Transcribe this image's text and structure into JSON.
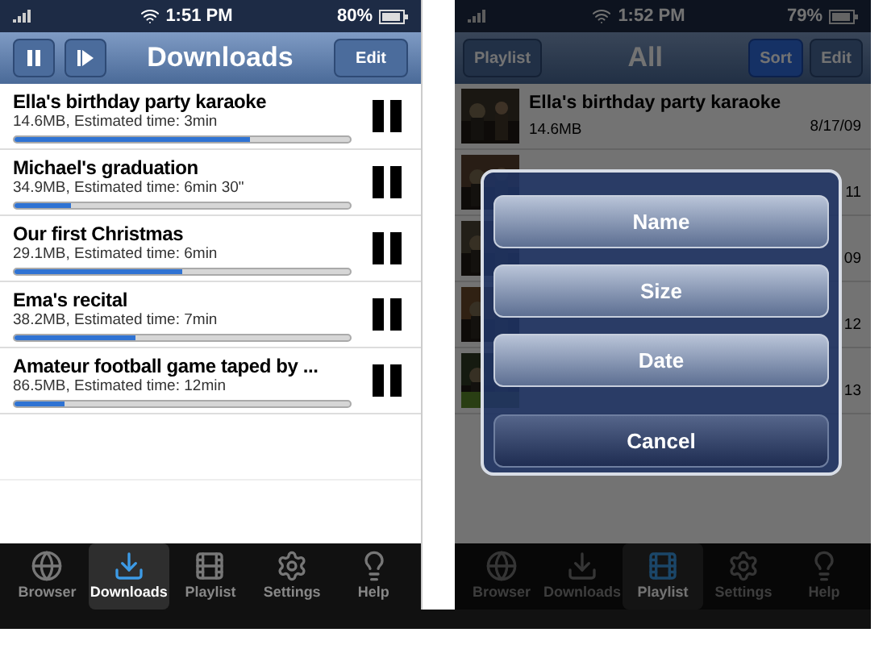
{
  "screens": [
    {
      "kind": "downloads",
      "status": {
        "time": "1:51 PM",
        "battery": "80%"
      },
      "nav": {
        "title": "Downloads",
        "button": "Edit"
      },
      "downloads": [
        {
          "title": "Ella's birthday party karaoke",
          "info": "14.6MB, Estimated time: 3min",
          "level": 0.7
        },
        {
          "title": "Michael's graduation",
          "info": "34.9MB, Estimated time: 6min 30\"",
          "level": 0.17
        },
        {
          "title": "Our first Christmas",
          "info": "29.1MB, Estimated time: 6min",
          "level": 0.5
        },
        {
          "title": "Ema's recital",
          "info": "38.2MB, Estimated time: 7min",
          "level": 0.36
        },
        {
          "title": "Amateur football game taped by ...",
          "info": "86.5MB, Estimated time: 12min",
          "level": 0.15
        }
      ],
      "tab_bar": [
        {
          "label": "Browser",
          "selected": false
        },
        {
          "label": "Downloads",
          "selected": true
        },
        {
          "label": "Playlist",
          "selected": false
        },
        {
          "label": "Settings",
          "selected": false
        },
        {
          "label": "Help",
          "selected": false
        }
      ]
    },
    {
      "kind": "playlist",
      "status": {
        "time": "1:52 PM",
        "battery": "79%"
      },
      "nav": {
        "back": "Playlist",
        "title": "All",
        "buttons": [
          {
            "label": "Sort",
            "selected": true
          },
          {
            "label": "Edit",
            "selected": false
          }
        ]
      },
      "items": [
        {
          "title": "Ella's birthday party karaoke",
          "size": "14.6MB",
          "date": "8/17/09"
        },
        {
          "date": "11"
        },
        {
          "date": "09"
        },
        {
          "date": "12"
        },
        {
          "date": "13"
        }
      ],
      "sort_sheet": {
        "options": [
          "Name",
          "Size",
          "Date"
        ],
        "cancel": "Cancel"
      },
      "tab_bar": [
        {
          "label": "Browser",
          "selected": false
        },
        {
          "label": "Downloads",
          "selected": false
        },
        {
          "label": "Playlist",
          "selected": true
        },
        {
          "label": "Settings",
          "selected": false
        },
        {
          "label": "Help",
          "selected": false
        }
      ]
    }
  ]
}
